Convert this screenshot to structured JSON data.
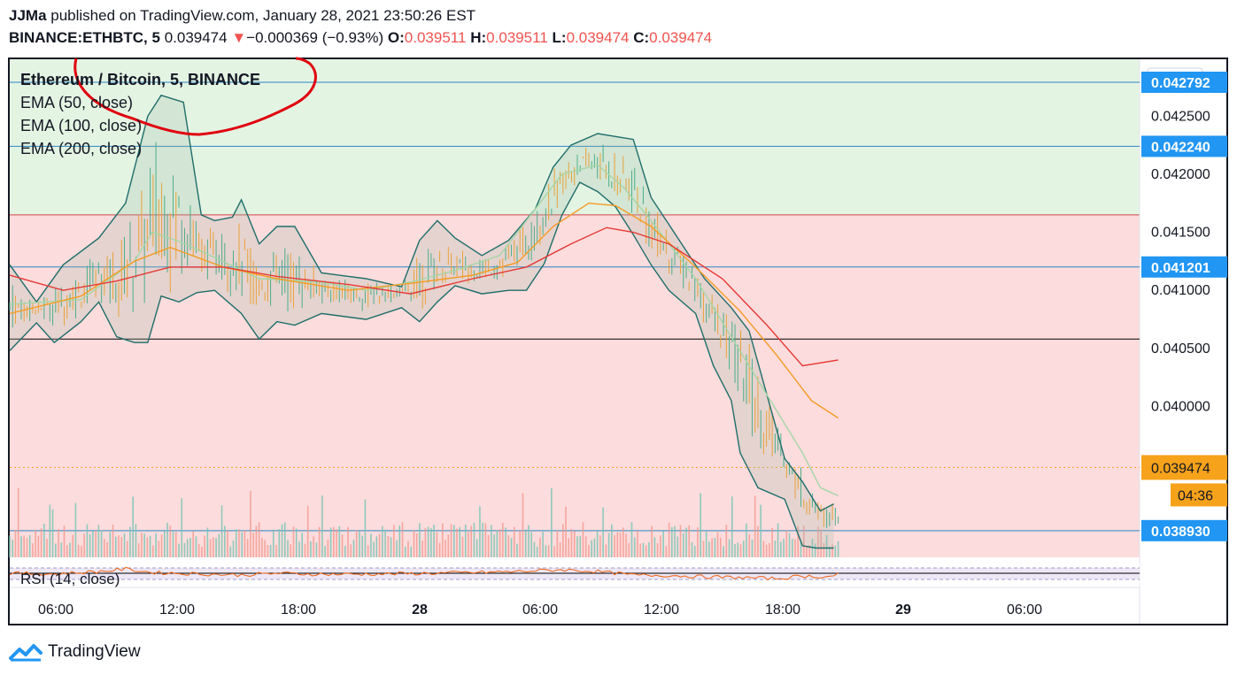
{
  "header": {
    "author": "JJMa",
    "published": "published on TradingView.com, January 28, 2021 23:50:26 EST",
    "symbol": "BINANCE:ETHBTC, 5",
    "price": "0.039474",
    "change_arrow": "▼",
    "change": "−0.000369 (−0.93%)",
    "o_label": "O:",
    "o_value": "0.039511",
    "h_label": "H:",
    "h_value": "0.039511",
    "l_label": "L:",
    "l_value": "0.039474",
    "c_label": "C:",
    "c_value": "0.039474"
  },
  "legend": {
    "title": "Ethereum / Bitcoin, 5, BINANCE",
    "ema50": "EMA (50, close)",
    "ema100": "EMA (100, close)",
    "ema200": "EMA (200, close)",
    "rsi": "RSI (14, close)"
  },
  "footer": {
    "brand": "TradingView"
  },
  "colors": {
    "green_zone": "#e4f4e3",
    "red_zone": "#fcdcdc",
    "bb": "#1f6e6b",
    "ema50": "#a5d6a7",
    "ema100": "#f59b24",
    "ema200": "#e53935",
    "hline": "#2a86c7",
    "price_tag": "#f7a21b",
    "level_tag": "#2196f3",
    "rsi": "#f06a1e",
    "annotation": "#e0000e"
  },
  "chart_data": {
    "type": "candlestick",
    "y_axis": {
      "currency": "BTC",
      "range": [
        0.0387,
        0.04299
      ],
      "ticks": [
        "0.042500",
        "0.042000",
        "0.041500",
        "0.041000",
        "0.040500",
        "0.040000"
      ]
    },
    "x_axis": {
      "ticks": [
        {
          "label": "06:00",
          "bold": false
        },
        {
          "label": "12:00",
          "bold": false
        },
        {
          "label": "18:00",
          "bold": false
        },
        {
          "label": "28",
          "bold": true
        },
        {
          "label": "06:00",
          "bold": false
        },
        {
          "label": "12:00",
          "bold": false
        },
        {
          "label": "18:00",
          "bold": false
        },
        {
          "label": "29",
          "bold": true
        },
        {
          "label": "06:00",
          "bold": false
        }
      ]
    },
    "zones": {
      "green": {
        "from": 0.04165,
        "to": 0.04299
      },
      "red": {
        "from": 0.0387,
        "to": 0.04165
      }
    },
    "levels": [
      {
        "value": 0.042792,
        "label": "0.042792"
      },
      {
        "value": 0.04224,
        "label": "0.042240"
      },
      {
        "value": 0.041201,
        "label": "0.041201"
      },
      {
        "value": 0.03893,
        "label": "0.038930"
      }
    ],
    "black_line": 0.04058,
    "last_price": {
      "value": 0.039474,
      "label": "0.039474",
      "countdown": "04:36"
    },
    "series": [
      {
        "name": "EMA (50, close)",
        "points": [
          [
            0.0,
            0.04088
          ],
          [
            0.08,
            0.04092
          ],
          [
            0.14,
            0.04125
          ],
          [
            0.16,
            0.0415
          ],
          [
            0.19,
            0.04142
          ],
          [
            0.22,
            0.04132
          ],
          [
            0.28,
            0.0411
          ],
          [
            0.35,
            0.04107
          ],
          [
            0.4,
            0.041
          ],
          [
            0.45,
            0.04107
          ],
          [
            0.5,
            0.04117
          ],
          [
            0.55,
            0.0413
          ],
          [
            0.59,
            0.0417
          ],
          [
            0.62,
            0.042
          ],
          [
            0.66,
            0.04208
          ],
          [
            0.69,
            0.04188
          ],
          [
            0.72,
            0.0416
          ],
          [
            0.77,
            0.0411
          ],
          [
            0.81,
            0.0406
          ],
          [
            0.85,
            0.0401
          ],
          [
            0.89,
            0.0396
          ],
          [
            0.91,
            0.0393
          ],
          [
            0.93,
            0.03923
          ]
        ]
      },
      {
        "name": "EMA (100, close)",
        "points": [
          [
            0.0,
            0.0408
          ],
          [
            0.08,
            0.04095
          ],
          [
            0.14,
            0.04125
          ],
          [
            0.18,
            0.04137
          ],
          [
            0.24,
            0.0412
          ],
          [
            0.3,
            0.0411
          ],
          [
            0.38,
            0.041
          ],
          [
            0.45,
            0.04106
          ],
          [
            0.52,
            0.04113
          ],
          [
            0.57,
            0.04124
          ],
          [
            0.61,
            0.04155
          ],
          [
            0.65,
            0.04175
          ],
          [
            0.68,
            0.04173
          ],
          [
            0.72,
            0.04155
          ],
          [
            0.77,
            0.0412
          ],
          [
            0.82,
            0.04082
          ],
          [
            0.86,
            0.04045
          ],
          [
            0.9,
            0.04005
          ],
          [
            0.93,
            0.0399
          ]
        ]
      },
      {
        "name": "EMA (200, close)",
        "points": [
          [
            0.0,
            0.04113
          ],
          [
            0.06,
            0.041
          ],
          [
            0.12,
            0.04108
          ],
          [
            0.18,
            0.0412
          ],
          [
            0.24,
            0.0412
          ],
          [
            0.3,
            0.04112
          ],
          [
            0.38,
            0.04105
          ],
          [
            0.45,
            0.04097
          ],
          [
            0.52,
            0.0411
          ],
          [
            0.58,
            0.0412
          ],
          [
            0.63,
            0.0414
          ],
          [
            0.67,
            0.04154
          ],
          [
            0.7,
            0.0415
          ],
          [
            0.74,
            0.0414
          ],
          [
            0.8,
            0.0411
          ],
          [
            0.85,
            0.0407
          ],
          [
            0.89,
            0.04035
          ],
          [
            0.93,
            0.0404
          ]
        ]
      },
      {
        "name": "BB upper",
        "points": [
          [
            0.0,
            0.04122
          ],
          [
            0.03,
            0.0409
          ],
          [
            0.06,
            0.04122
          ],
          [
            0.1,
            0.04145
          ],
          [
            0.13,
            0.04175
          ],
          [
            0.155,
            0.0425
          ],
          [
            0.17,
            0.04268
          ],
          [
            0.195,
            0.04262
          ],
          [
            0.215,
            0.04165
          ],
          [
            0.23,
            0.0416
          ],
          [
            0.25,
            0.04163
          ],
          [
            0.26,
            0.04178
          ],
          [
            0.28,
            0.0414
          ],
          [
            0.3,
            0.04155
          ],
          [
            0.32,
            0.04155
          ],
          [
            0.35,
            0.04115
          ],
          [
            0.4,
            0.0411
          ],
          [
            0.44,
            0.04103
          ],
          [
            0.46,
            0.04143
          ],
          [
            0.48,
            0.0416
          ],
          [
            0.5,
            0.04145
          ],
          [
            0.53,
            0.0413
          ],
          [
            0.56,
            0.04143
          ],
          [
            0.59,
            0.0417
          ],
          [
            0.61,
            0.04206
          ],
          [
            0.63,
            0.04225
          ],
          [
            0.66,
            0.04235
          ],
          [
            0.7,
            0.0423
          ],
          [
            0.72,
            0.0418
          ],
          [
            0.75,
            0.04145
          ],
          [
            0.78,
            0.0411
          ],
          [
            0.81,
            0.04085
          ],
          [
            0.83,
            0.04065
          ],
          [
            0.85,
            0.0401
          ],
          [
            0.87,
            0.03955
          ],
          [
            0.89,
            0.03935
          ],
          [
            0.91,
            0.0391
          ],
          [
            0.925,
            0.03916
          ]
        ]
      },
      {
        "name": "BB lower",
        "points": [
          [
            0.0,
            0.04048
          ],
          [
            0.03,
            0.04072
          ],
          [
            0.05,
            0.04055
          ],
          [
            0.08,
            0.04073
          ],
          [
            0.1,
            0.0409
          ],
          [
            0.12,
            0.0406
          ],
          [
            0.14,
            0.04055
          ],
          [
            0.155,
            0.04055
          ],
          [
            0.17,
            0.04095
          ],
          [
            0.19,
            0.0409
          ],
          [
            0.21,
            0.04098
          ],
          [
            0.23,
            0.041
          ],
          [
            0.26,
            0.0408
          ],
          [
            0.28,
            0.04058
          ],
          [
            0.3,
            0.04073
          ],
          [
            0.32,
            0.0407
          ],
          [
            0.35,
            0.0408
          ],
          [
            0.4,
            0.04075
          ],
          [
            0.44,
            0.04085
          ],
          [
            0.46,
            0.04073
          ],
          [
            0.48,
            0.0409
          ],
          [
            0.5,
            0.04104
          ],
          [
            0.53,
            0.04097
          ],
          [
            0.56,
            0.041
          ],
          [
            0.58,
            0.041
          ],
          [
            0.6,
            0.04123
          ],
          [
            0.62,
            0.04165
          ],
          [
            0.64,
            0.04193
          ],
          [
            0.66,
            0.04185
          ],
          [
            0.68,
            0.04172
          ],
          [
            0.7,
            0.04148
          ],
          [
            0.72,
            0.04122
          ],
          [
            0.74,
            0.041
          ],
          [
            0.77,
            0.0408
          ],
          [
            0.79,
            0.04035
          ],
          [
            0.81,
            0.04005
          ],
          [
            0.82,
            0.0396
          ],
          [
            0.84,
            0.0393
          ],
          [
            0.87,
            0.0392
          ],
          [
            0.89,
            0.0388
          ],
          [
            0.905,
            0.03878
          ],
          [
            0.925,
            0.03878
          ]
        ]
      },
      {
        "name": "RSI (14, close)",
        "points": [
          [
            0.0,
            50
          ],
          [
            0.05,
            48
          ],
          [
            0.1,
            55
          ],
          [
            0.13,
            62
          ],
          [
            0.16,
            52
          ],
          [
            0.2,
            49
          ],
          [
            0.26,
            45
          ],
          [
            0.3,
            50
          ],
          [
            0.35,
            47
          ],
          [
            0.42,
            48
          ],
          [
            0.47,
            50
          ],
          [
            0.52,
            52
          ],
          [
            0.56,
            54
          ],
          [
            0.62,
            60
          ],
          [
            0.66,
            55
          ],
          [
            0.7,
            45
          ],
          [
            0.74,
            44
          ],
          [
            0.78,
            40
          ],
          [
            0.82,
            38
          ],
          [
            0.86,
            35
          ],
          [
            0.89,
            42
          ],
          [
            0.92,
            40
          ],
          [
            0.93,
            48
          ]
        ]
      }
    ]
  }
}
